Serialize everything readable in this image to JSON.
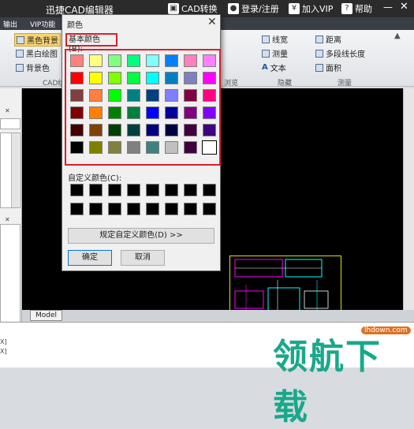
{
  "titlebar": {
    "app_title": "迅捷CAD编辑器",
    "cad_convert": "CAD转换",
    "login": "登录/注册",
    "join_vip": "加入VIP",
    "help": "帮助",
    "minimize": "—",
    "close": "✕"
  },
  "menubar": {
    "items": [
      "输出",
      "VIP功能"
    ]
  },
  "ribbon": {
    "black_bg": "黑色背景",
    "black_white": "黑白绘图",
    "bg_color": "背景色",
    "group_cad": "CAD绘",
    "line_width": "线宽",
    "measure": "测量",
    "text": "文本",
    "distance": "距离",
    "polyline_length": "多段线长度",
    "area": "面积",
    "group_browse": "浏览",
    "group_hide": "隐藏",
    "group_measure": "测量",
    "collapse": "▲"
  },
  "left_panel": {
    "close_1": "✕",
    "close_2": "✕"
  },
  "canvas": {
    "model_tab": "Model"
  },
  "cmd": {
    "line1": "X]",
    "line2": "X]"
  },
  "watermark": {
    "site": "lhdown.com",
    "text": "领航下载"
  },
  "dialog": {
    "title": "颜色",
    "close": "✕",
    "basic_colors_label": "基本颜色(B):",
    "custom_colors_label": "自定义颜色(C):",
    "define_custom_button": "规定自定义颜色(D) >>",
    "ok_button": "确定",
    "cancel_button": "取消",
    "basic_colors": [
      [
        "#ff8080",
        "#ffff80",
        "#80ff80",
        "#00ff80",
        "#80ffff",
        "#0080ff",
        "#ff80c0",
        "#ff80ff"
      ],
      [
        "#ff0000",
        "#ffff00",
        "#80ff00",
        "#00ff40",
        "#00ffff",
        "#0080c0",
        "#8080c0",
        "#ff00ff"
      ],
      [
        "#804040",
        "#ff8040",
        "#00ff00",
        "#008080",
        "#004080",
        "#8080ff",
        "#800040",
        "#ff0080"
      ],
      [
        "#800000",
        "#ff8000",
        "#008000",
        "#008040",
        "#0000ff",
        "#0000a0",
        "#800080",
        "#8000ff"
      ],
      [
        "#400000",
        "#804000",
        "#004000",
        "#004040",
        "#000080",
        "#000040",
        "#400040",
        "#400080"
      ],
      [
        "#000000",
        "#808000",
        "#808040",
        "#808080",
        "#408080",
        "#c0c0c0",
        "#400040",
        "#ffffff"
      ]
    ],
    "selected_color": "#ffffff"
  }
}
